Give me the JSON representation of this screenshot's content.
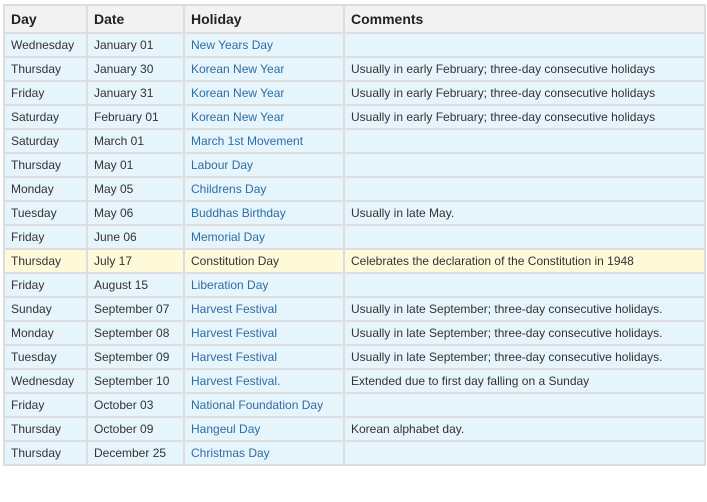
{
  "table": {
    "headers": [
      "Day",
      "Date",
      "Holiday",
      "Comments"
    ],
    "rows": [
      {
        "day": "Wednesday",
        "date": "January 01",
        "holiday": "New Years Day",
        "comment": ""
      },
      {
        "day": "Thursday",
        "date": "January 30",
        "holiday": "Korean New Year",
        "comment": "Usually in early February; three-day consecutive holidays"
      },
      {
        "day": "Friday",
        "date": "January 31",
        "holiday": "Korean New Year",
        "comment": "Usually in early February; three-day consecutive holidays"
      },
      {
        "day": "Saturday",
        "date": "February 01",
        "holiday": "Korean New Year",
        "comment": "Usually in early February; three-day consecutive holidays"
      },
      {
        "day": "Saturday",
        "date": "March 01",
        "holiday": "March 1st Movement",
        "comment": ""
      },
      {
        "day": "Thursday",
        "date": "May 01",
        "holiday": "Labour Day",
        "comment": ""
      },
      {
        "day": "Monday",
        "date": "May 05",
        "holiday": "Childrens Day",
        "comment": ""
      },
      {
        "day": "Tuesday",
        "date": "May 06",
        "holiday": "Buddhas Birthday",
        "comment": "Usually in late May."
      },
      {
        "day": "Friday",
        "date": "June 06",
        "holiday": "Memorial Day",
        "comment": ""
      },
      {
        "day": "Thursday",
        "date": "July 17",
        "holiday": "Constitution Day",
        "comment": "Celebrates the declaration of the Constitution in 1948",
        "highlight": true
      },
      {
        "day": "Friday",
        "date": "August 15",
        "holiday": "Liberation Day",
        "comment": ""
      },
      {
        "day": "Sunday",
        "date": "September 07",
        "holiday": "Harvest Festival",
        "comment": "Usually in late September; three-day consecutive holidays."
      },
      {
        "day": "Monday",
        "date": "September 08",
        "holiday": "Harvest Festival",
        "comment": "Usually in late September; three-day consecutive holidays."
      },
      {
        "day": "Tuesday",
        "date": "September 09",
        "holiday": "Harvest Festival",
        "comment": "Usually in late September; three-day consecutive holidays."
      },
      {
        "day": "Wednesday",
        "date": "September 10",
        "holiday": "Harvest Festival.",
        "comment": "Extended due to first day falling on a Sunday"
      },
      {
        "day": "Friday",
        "date": "October 03",
        "holiday": "National Foundation Day",
        "comment": ""
      },
      {
        "day": "Thursday",
        "date": "October 09",
        "holiday": "Hangeul Day",
        "comment": "Korean alphabet day."
      },
      {
        "day": "Thursday",
        "date": "December 25",
        "holiday": "Christmas Day",
        "comment": ""
      }
    ]
  },
  "colors": {
    "row_background": "#e6f4fb",
    "highlight_background": "#fef9d8",
    "header_background": "#f2f2f2",
    "link": "#2e6da4",
    "border": "#dddddd"
  }
}
